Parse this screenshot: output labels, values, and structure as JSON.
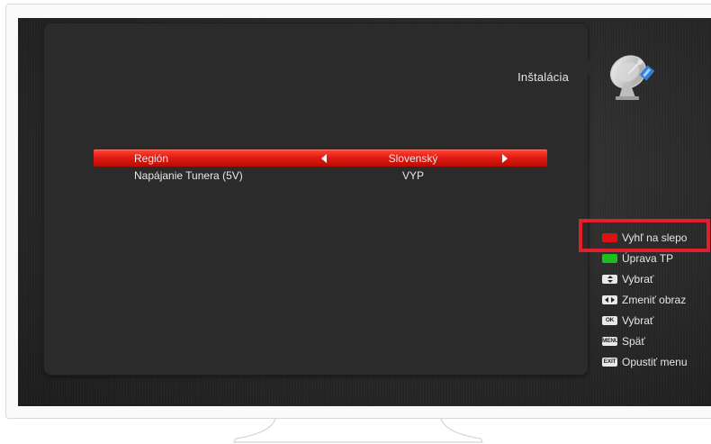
{
  "menu": {
    "title": "Inštalácia",
    "icon": "satellite-dish-icon"
  },
  "rows": [
    {
      "label": "Región",
      "value": "Slovenský",
      "selected": true
    },
    {
      "label": "Napájanie Tunera (5V)",
      "value": "VYP",
      "selected": false
    }
  ],
  "help": [
    {
      "key": "red-key-icon",
      "label": "Vyhľ na slepo"
    },
    {
      "key": "green-key-icon",
      "label": "Úprava TP"
    },
    {
      "key": "up-down-key-icon",
      "label": "Vybrať"
    },
    {
      "key": "left-right-key-icon",
      "label": "Zmeniť obraz"
    },
    {
      "key": "ok-key-icon",
      "key_text": "OK",
      "label": "Vybrať"
    },
    {
      "key": "menu-key-icon",
      "key_text": "MENU",
      "label": "Späť"
    },
    {
      "key": "exit-key-icon",
      "key_text": "EXIT",
      "label": "Opustiť menu"
    }
  ],
  "colors": {
    "selected_row": "#e21c12",
    "highlight_box": "#e0202a",
    "red_key": "#e01010",
    "green_key": "#19c019"
  }
}
